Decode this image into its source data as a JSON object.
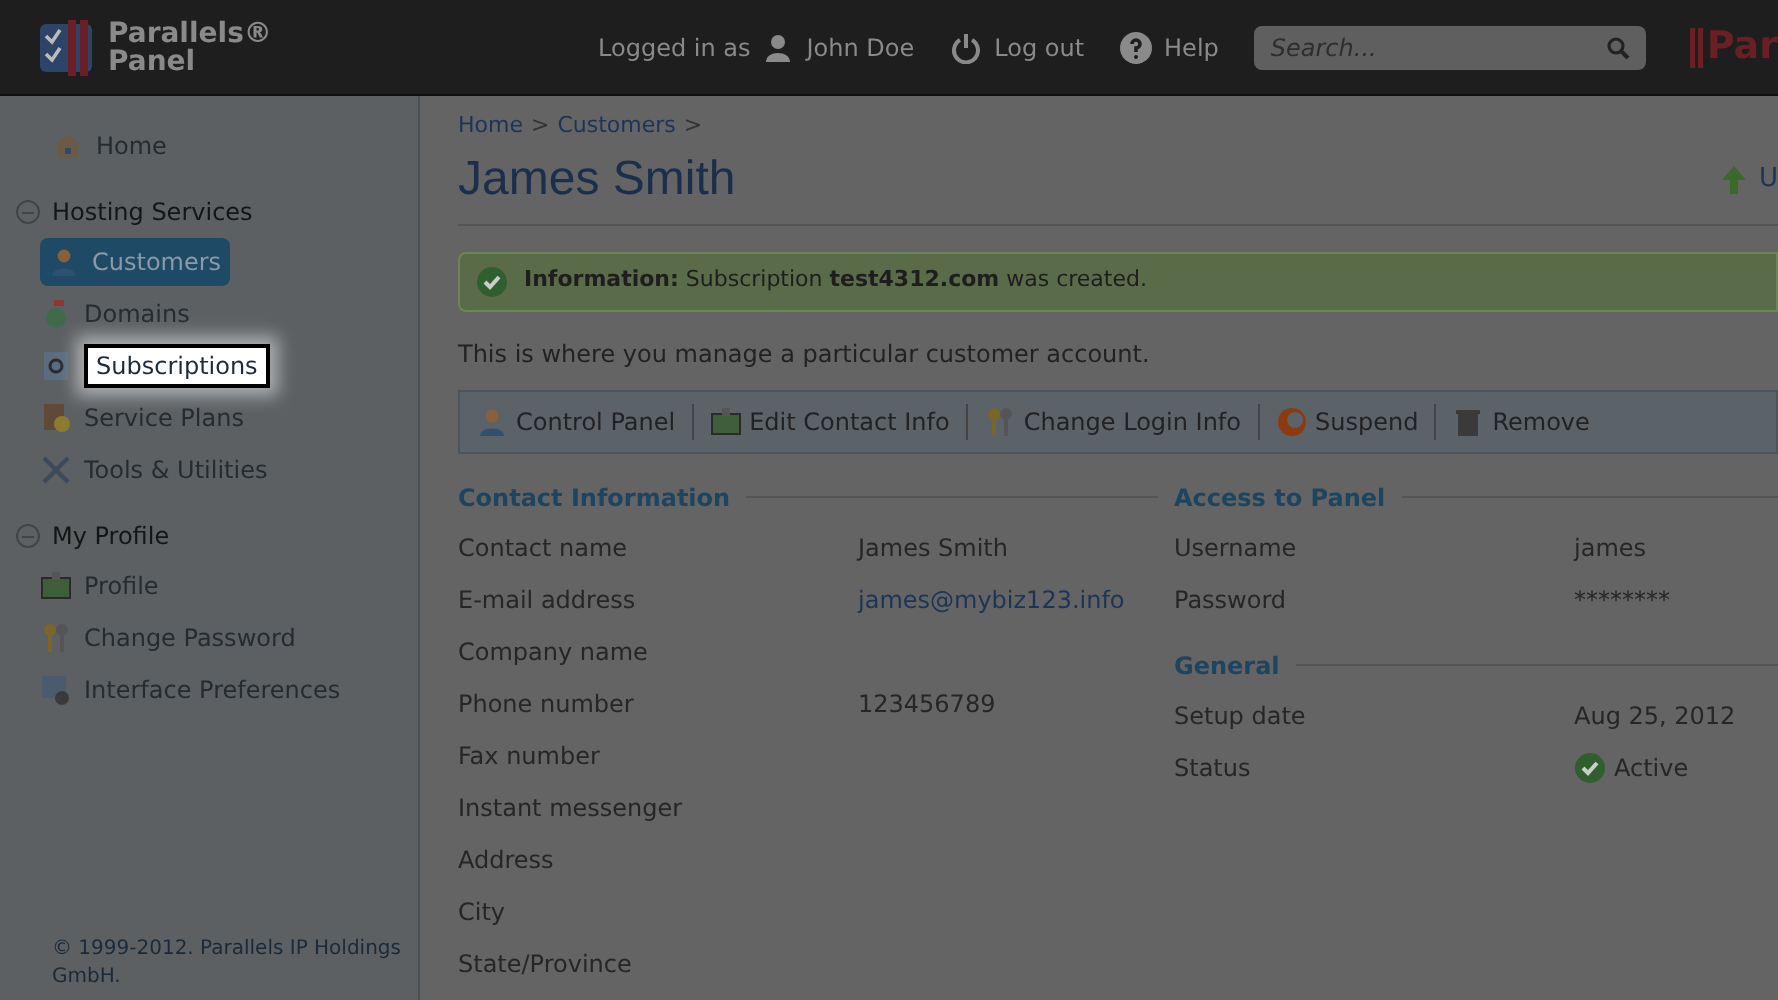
{
  "header": {
    "logo_line1": "Parallels®",
    "logo_line2": "Panel",
    "logged_in_as": "Logged in as",
    "user": "John Doe",
    "logout": "Log out",
    "help": "Help",
    "search": {
      "placeholder": "Search..."
    },
    "brand_fragment": "Par"
  },
  "sidebar": {
    "items": [
      {
        "kind": "link",
        "label": "Home",
        "selected": false,
        "highlighted": false
      },
      {
        "kind": "group",
        "label": "Hosting Services",
        "expanded": true,
        "children": [
          {
            "label": "Customers",
            "selected": true,
            "highlighted": false
          },
          {
            "label": "Domains",
            "selected": false,
            "highlighted": false
          },
          {
            "label": "Subscriptions",
            "selected": false,
            "highlighted": true
          },
          {
            "label": "Service Plans",
            "selected": false,
            "highlighted": false
          },
          {
            "label": "Tools & Utilities",
            "selected": false,
            "highlighted": false
          }
        ]
      },
      {
        "kind": "group",
        "label": "My Profile",
        "expanded": true,
        "children": [
          {
            "label": "Profile",
            "selected": false,
            "highlighted": false
          },
          {
            "label": "Change Password",
            "selected": false,
            "highlighted": false
          },
          {
            "label": "Interface Preferences",
            "selected": false,
            "highlighted": false
          }
        ]
      }
    ],
    "copyright": "© 1999-2012. Parallels IP Holdings GmbH."
  },
  "breadcrumbs": [
    {
      "label": "Home",
      "separator": ">"
    },
    {
      "label": "Customers",
      "separator": ">"
    }
  ],
  "title": "James Smith",
  "top_right_link": "U",
  "message": {
    "text": "**Information:** Subscription **test4312.com** was created."
  },
  "description": "This is where you manage a particular customer account.",
  "toolbar": [
    "Control Panel",
    "Edit Contact Info",
    "Change Login Info",
    "Suspend",
    "Remove"
  ],
  "left_sections": [
    {
      "title": "Contact Information",
      "rows": [
        {
          "label": "Contact name",
          "value": "James Smith",
          "kind": "text"
        },
        {
          "label": "E-mail address",
          "value": "james@mybiz123.info",
          "kind": "link"
        },
        {
          "label": "Company name"
        },
        {
          "label": "Phone number",
          "value": "123456789",
          "kind": "text"
        },
        {
          "label": "Fax number"
        },
        {
          "label": "Instant messenger"
        },
        {
          "label": "Address"
        },
        {
          "label": "City"
        },
        {
          "label": "State/Province"
        }
      ]
    }
  ],
  "right_sections": [
    {
      "title": "Access to Panel",
      "rows": [
        {
          "label": "Username",
          "value": "james",
          "kind": "text"
        },
        {
          "label": "Password",
          "value": "********",
          "kind": "text"
        }
      ]
    },
    {
      "title": "General",
      "rows": [
        {
          "label": "Setup date",
          "value": "Aug 25, 2012",
          "kind": "text"
        },
        {
          "label": "Status",
          "value": "Active",
          "kind": "status"
        }
      ]
    }
  ]
}
